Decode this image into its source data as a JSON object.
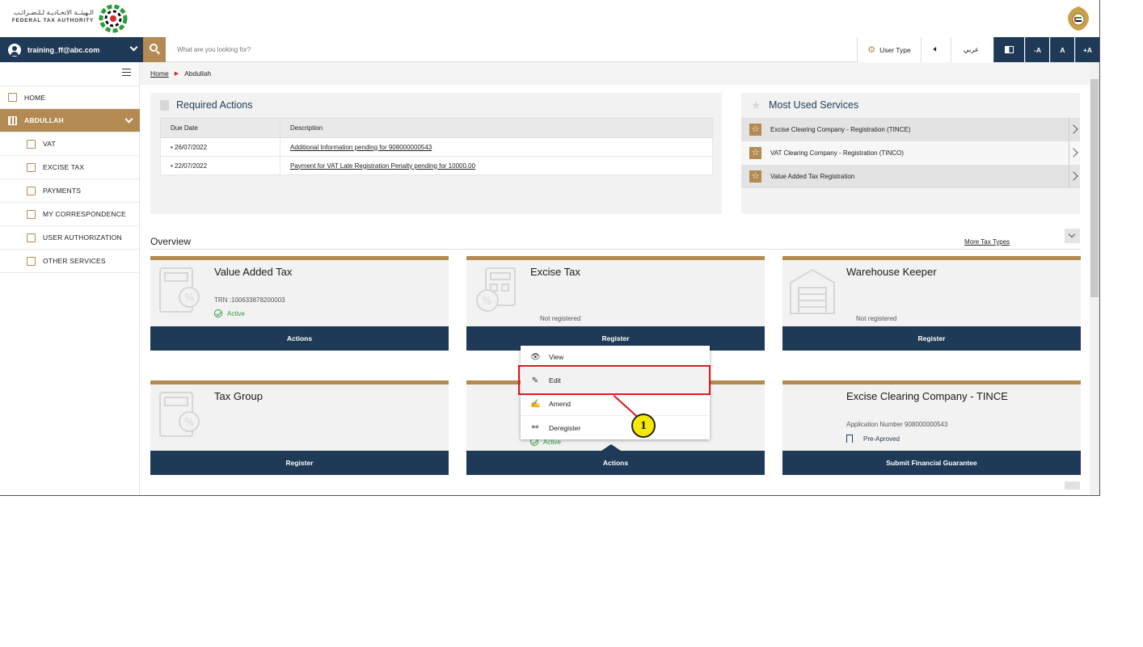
{
  "header": {
    "logo_arabic": "الـهيئــة الاتحـاديـة لـلـضـرائـب",
    "logo_english": "FEDERAL TAX AUTHORITY"
  },
  "topbar": {
    "user_email": "training_ff@abc.com",
    "search_placeholder": "What are you looking for?",
    "user_type_label": "User Type",
    "language_label": "عربي",
    "font_decrease": "-A",
    "font_normal": "A",
    "font_increase": "+A"
  },
  "sidebar": {
    "home": "HOME",
    "group": "ABDULLAH",
    "items": [
      "VAT",
      "EXCISE TAX",
      "PAYMENTS",
      "MY CORRESPONDENCE",
      "USER AUTHORIZATION",
      "OTHER SERVICES"
    ]
  },
  "breadcrumb": {
    "home": "Home",
    "current": "Abdullah"
  },
  "required_actions": {
    "title": "Required Actions",
    "columns": [
      "Due Date",
      "Description"
    ],
    "rows": [
      {
        "date": "• 26/07/2022",
        "description": "Additional Information pending for 908000000543"
      },
      {
        "date": "• 22/07/2022",
        "description": "Payment for VAT Late Registration Penalty pending for 10000.00"
      }
    ]
  },
  "most_used": {
    "title": "Most Used Services",
    "items": [
      "Excise Clearing Company - Registration (TINCE)",
      "VAT Clearing Company - Registration (TINCO)",
      "Value Added Tax Registration"
    ]
  },
  "overview": {
    "title": "Overview",
    "more_link": "More Tax Types",
    "cards": [
      {
        "title": "Value Added Tax",
        "sub": "TRN :100633878200003",
        "status": "Active",
        "button": "Actions"
      },
      {
        "title": "Excise Tax",
        "sub": "Not registered",
        "button": "Register"
      },
      {
        "title": "Warehouse Keeper",
        "sub": "Not registered",
        "button": "Register"
      },
      {
        "title": "Tax Group",
        "button": "Register"
      },
      {
        "status": "Active",
        "button": "Actions"
      },
      {
        "title": "Excise Clearing Company - TINCE",
        "sub": "Application Number 908000000543",
        "status": "Pre-Aproved",
        "button": "Submit Financial Guarantee"
      }
    ]
  },
  "actions_menu": {
    "items": [
      "View",
      "Edit",
      "Amend",
      "Deregister"
    ]
  },
  "annotation": {
    "step_number": "1",
    "highlight_color": "#e0161b",
    "marker_color": "#f5e70a"
  },
  "colors": {
    "navy": "#1f3a57",
    "gold": "#b38b52",
    "active_green": "#2e9a3a"
  }
}
